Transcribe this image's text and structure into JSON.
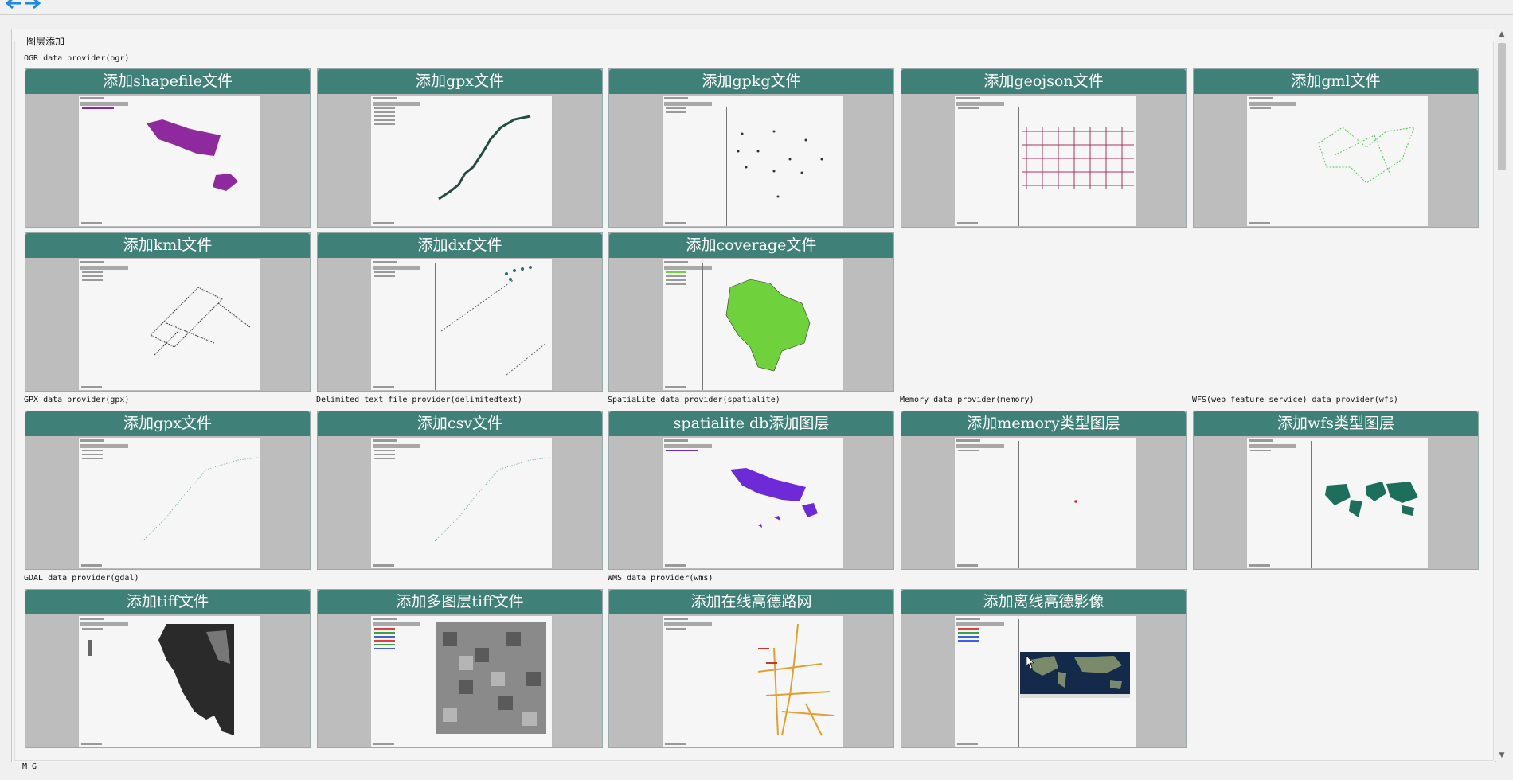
{
  "group": {
    "title": "图层添加"
  },
  "sections": {
    "ogr": "OGR data provider(ogr)",
    "gpx": "GPX data provider(gpx)",
    "delimited": "Delimited text file provider(delimitedtext)",
    "spatialite": "SpatiaLite data provider(spatialite)",
    "memory": "Memory data provider(memory)",
    "wfs": "WFS(web feature service) data provider(wfs)",
    "gdal": "GDAL data provider(gdal)",
    "wms": "WMS data provider(wms)"
  },
  "cards": {
    "shapefile": "添加shapefile文件",
    "gpx": "添加gpx文件",
    "gpkg": "添加gpkg文件",
    "geojson": "添加geojson文件",
    "gml": "添加gml文件",
    "kml": "添加kml文件",
    "dxf": "添加dxf文件",
    "coverage": "添加coverage文件",
    "gpx2": "添加gpx文件",
    "csv": "添加csv文件",
    "spatialite_db": "spatialite db添加图层",
    "memory": "添加memory类型图层",
    "wfs": "添加wfs类型图层",
    "tiff": "添加tiff文件",
    "multi_tiff": "添加多图层tiff文件",
    "amap_road": "添加在线高德路网",
    "amap_image": "添加离线高德影像"
  },
  "bottom_label": "M  G",
  "colors": {
    "header": "#3f8078",
    "card_bg": "#bdbdbd"
  }
}
